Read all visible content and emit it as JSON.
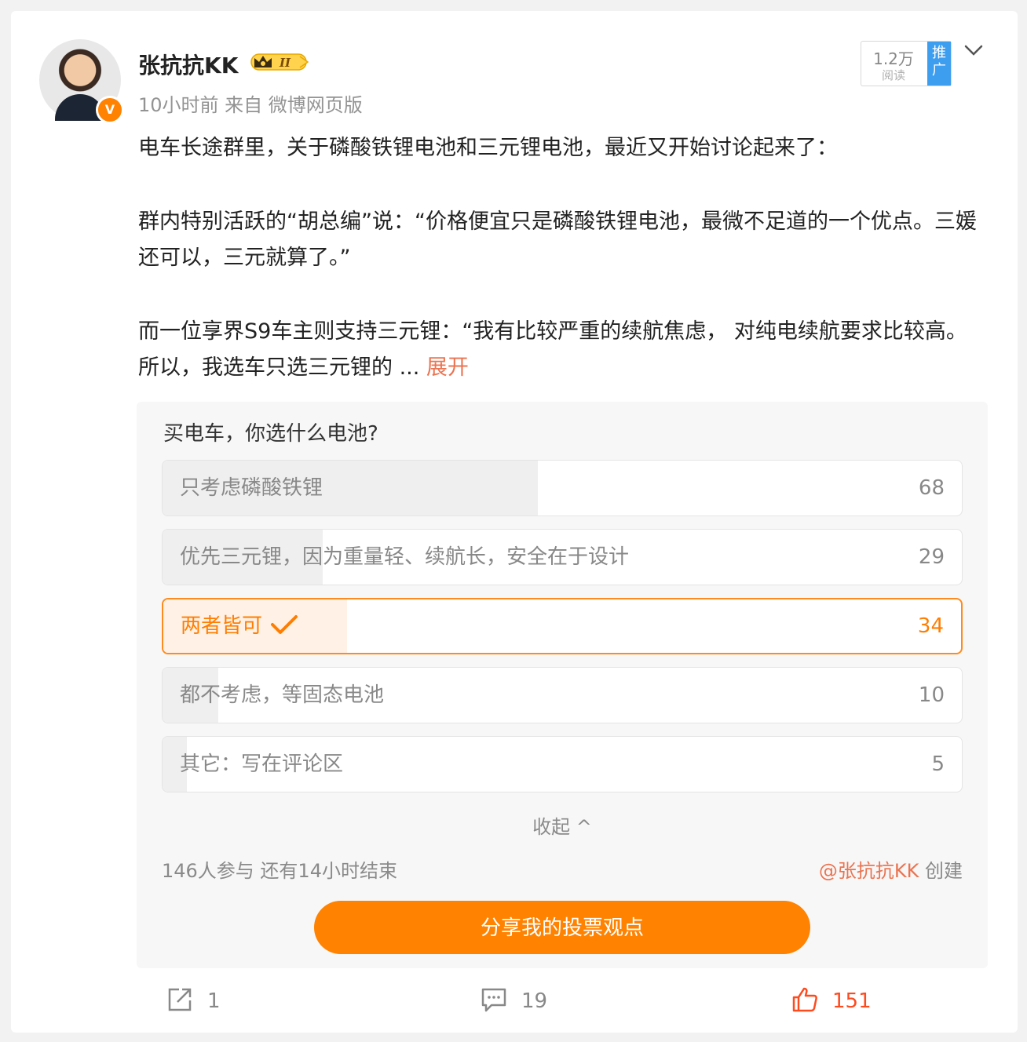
{
  "header": {
    "username": "张抗抗KK",
    "meta": "10小时前 来自 微博网页版",
    "badge_level": "II",
    "verified_mark": "V"
  },
  "reads": {
    "count": "1.2万",
    "label": "阅读",
    "promo_label": "推广"
  },
  "post": {
    "p1": "电车长途群里，关于磷酸铁锂电池和三元锂电池，最近又开始讨论起来了：",
    "p2": "群内特别活跃的“胡总编”说：“价格便宜只是磷酸铁锂电池，最微不足道的一个优点。三媛还可以，三元就算了。”",
    "p3": "而一位享界S9车主则支持三元锂：“我有比较严重的续航焦虑， 对纯电续航要求比较高。 所以，我选车只选三元锂的 ... ",
    "expand_label": "展开"
  },
  "poll": {
    "question": "买电车，你选什么电池?",
    "options": [
      {
        "label": "只考虑磷酸铁锂",
        "count": "68",
        "ratio": 0.47,
        "selected": false
      },
      {
        "label": "优先三元锂，因为重量轻、续航长，安全在于设计",
        "count": "29",
        "ratio": 0.2,
        "selected": false
      },
      {
        "label": "两者皆可",
        "count": "34",
        "ratio": 0.23,
        "selected": true
      },
      {
        "label": "都不考虑，等固态电池",
        "count": "10",
        "ratio": 0.07,
        "selected": false
      },
      {
        "label": "其它：写在评论区",
        "count": "5",
        "ratio": 0.03,
        "selected": false
      }
    ],
    "collapse_label": "收起 ^",
    "participants": "146人参与 还有14小时结束",
    "creator_at": "@张抗抗KK",
    "creator_suffix": " 创建",
    "share_label": "分享我的投票观点"
  },
  "actions": {
    "forward_count": "1",
    "comment_count": "19",
    "like_count": "151"
  },
  "colors": {
    "accent": "#ff8200",
    "link": "#eb7350",
    "like": "#ff4a1e",
    "promo": "#3d9ef0"
  }
}
